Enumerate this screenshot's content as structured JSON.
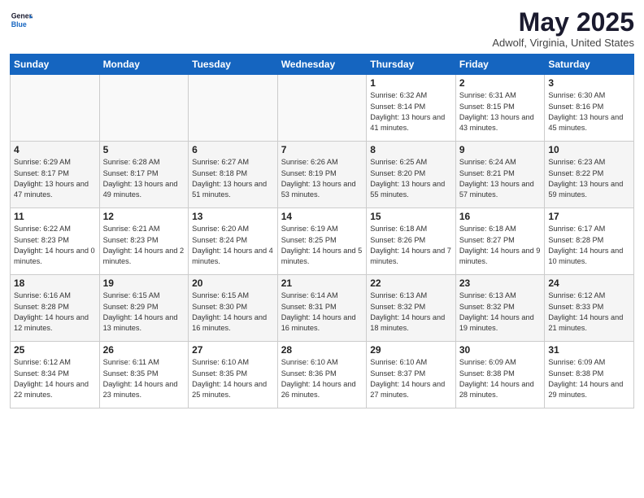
{
  "logo": {
    "general": "General",
    "blue": "Blue"
  },
  "header": {
    "month": "May 2025",
    "location": "Adwolf, Virginia, United States"
  },
  "days_of_week": [
    "Sunday",
    "Monday",
    "Tuesday",
    "Wednesday",
    "Thursday",
    "Friday",
    "Saturday"
  ],
  "weeks": [
    [
      {
        "day": "",
        "info": ""
      },
      {
        "day": "",
        "info": ""
      },
      {
        "day": "",
        "info": ""
      },
      {
        "day": "",
        "info": ""
      },
      {
        "day": "1",
        "info": "Sunrise: 6:32 AM\nSunset: 8:14 PM\nDaylight: 13 hours and 41 minutes."
      },
      {
        "day": "2",
        "info": "Sunrise: 6:31 AM\nSunset: 8:15 PM\nDaylight: 13 hours and 43 minutes."
      },
      {
        "day": "3",
        "info": "Sunrise: 6:30 AM\nSunset: 8:16 PM\nDaylight: 13 hours and 45 minutes."
      }
    ],
    [
      {
        "day": "4",
        "info": "Sunrise: 6:29 AM\nSunset: 8:17 PM\nDaylight: 13 hours and 47 minutes."
      },
      {
        "day": "5",
        "info": "Sunrise: 6:28 AM\nSunset: 8:17 PM\nDaylight: 13 hours and 49 minutes."
      },
      {
        "day": "6",
        "info": "Sunrise: 6:27 AM\nSunset: 8:18 PM\nDaylight: 13 hours and 51 minutes."
      },
      {
        "day": "7",
        "info": "Sunrise: 6:26 AM\nSunset: 8:19 PM\nDaylight: 13 hours and 53 minutes."
      },
      {
        "day": "8",
        "info": "Sunrise: 6:25 AM\nSunset: 8:20 PM\nDaylight: 13 hours and 55 minutes."
      },
      {
        "day": "9",
        "info": "Sunrise: 6:24 AM\nSunset: 8:21 PM\nDaylight: 13 hours and 57 minutes."
      },
      {
        "day": "10",
        "info": "Sunrise: 6:23 AM\nSunset: 8:22 PM\nDaylight: 13 hours and 59 minutes."
      }
    ],
    [
      {
        "day": "11",
        "info": "Sunrise: 6:22 AM\nSunset: 8:23 PM\nDaylight: 14 hours and 0 minutes."
      },
      {
        "day": "12",
        "info": "Sunrise: 6:21 AM\nSunset: 8:23 PM\nDaylight: 14 hours and 2 minutes."
      },
      {
        "day": "13",
        "info": "Sunrise: 6:20 AM\nSunset: 8:24 PM\nDaylight: 14 hours and 4 minutes."
      },
      {
        "day": "14",
        "info": "Sunrise: 6:19 AM\nSunset: 8:25 PM\nDaylight: 14 hours and 5 minutes."
      },
      {
        "day": "15",
        "info": "Sunrise: 6:18 AM\nSunset: 8:26 PM\nDaylight: 14 hours and 7 minutes."
      },
      {
        "day": "16",
        "info": "Sunrise: 6:18 AM\nSunset: 8:27 PM\nDaylight: 14 hours and 9 minutes."
      },
      {
        "day": "17",
        "info": "Sunrise: 6:17 AM\nSunset: 8:28 PM\nDaylight: 14 hours and 10 minutes."
      }
    ],
    [
      {
        "day": "18",
        "info": "Sunrise: 6:16 AM\nSunset: 8:28 PM\nDaylight: 14 hours and 12 minutes."
      },
      {
        "day": "19",
        "info": "Sunrise: 6:15 AM\nSunset: 8:29 PM\nDaylight: 14 hours and 13 minutes."
      },
      {
        "day": "20",
        "info": "Sunrise: 6:15 AM\nSunset: 8:30 PM\nDaylight: 14 hours and 16 minutes."
      },
      {
        "day": "21",
        "info": "Sunrise: 6:14 AM\nSunset: 8:31 PM\nDaylight: 14 hours and 16 minutes."
      },
      {
        "day": "22",
        "info": "Sunrise: 6:13 AM\nSunset: 8:32 PM\nDaylight: 14 hours and 18 minutes."
      },
      {
        "day": "23",
        "info": "Sunrise: 6:13 AM\nSunset: 8:32 PM\nDaylight: 14 hours and 19 minutes."
      },
      {
        "day": "24",
        "info": "Sunrise: 6:12 AM\nSunset: 8:33 PM\nDaylight: 14 hours and 21 minutes."
      }
    ],
    [
      {
        "day": "25",
        "info": "Sunrise: 6:12 AM\nSunset: 8:34 PM\nDaylight: 14 hours and 22 minutes."
      },
      {
        "day": "26",
        "info": "Sunrise: 6:11 AM\nSunset: 8:35 PM\nDaylight: 14 hours and 23 minutes."
      },
      {
        "day": "27",
        "info": "Sunrise: 6:10 AM\nSunset: 8:35 PM\nDaylight: 14 hours and 25 minutes."
      },
      {
        "day": "28",
        "info": "Sunrise: 6:10 AM\nSunset: 8:36 PM\nDaylight: 14 hours and 26 minutes."
      },
      {
        "day": "29",
        "info": "Sunrise: 6:10 AM\nSunset: 8:37 PM\nDaylight: 14 hours and 27 minutes."
      },
      {
        "day": "30",
        "info": "Sunrise: 6:09 AM\nSunset: 8:38 PM\nDaylight: 14 hours and 28 minutes."
      },
      {
        "day": "31",
        "info": "Sunrise: 6:09 AM\nSunset: 8:38 PM\nDaylight: 14 hours and 29 minutes."
      }
    ]
  ]
}
